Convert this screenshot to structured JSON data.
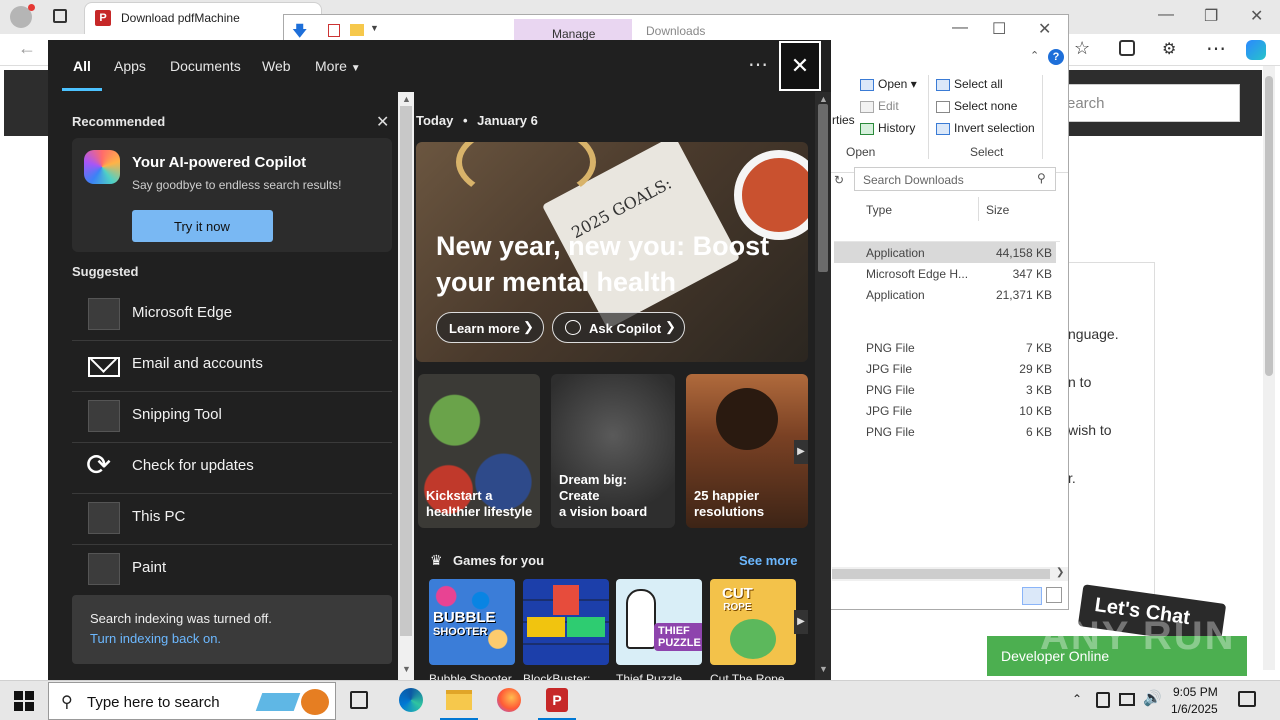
{
  "browser": {
    "tab_title": "Download pdfMachine",
    "page_search_placeholder": "earch",
    "page_text_lines": [
      "nguage.",
      "n to",
      "wish to",
      "r."
    ]
  },
  "explorer": {
    "manage_label": "Manage",
    "title": "Downloads",
    "ribbon": {
      "open_label": "Open",
      "edit_label": "Edit",
      "history_label": "History",
      "open_group": "Open",
      "properties_partial": "rties",
      "select_all": "Select all",
      "select_none": "Select none",
      "invert_selection": "Invert selection",
      "select_group": "Select"
    },
    "search_placeholder": "Search Downloads",
    "columns": [
      "Type",
      "Size"
    ],
    "rows": [
      {
        "type": "Application",
        "size": "44,158 KB"
      },
      {
        "type": "Microsoft Edge H...",
        "size": "347 KB"
      },
      {
        "type": "Application",
        "size": "21,371 KB"
      },
      {
        "type": "PNG File",
        "size": "7 KB"
      },
      {
        "type": "JPG File",
        "size": "29 KB"
      },
      {
        "type": "PNG File",
        "size": "3 KB"
      },
      {
        "type": "JPG File",
        "size": "10 KB"
      },
      {
        "type": "PNG File",
        "size": "6 KB"
      }
    ]
  },
  "search_panel": {
    "tabs": [
      "All",
      "Apps",
      "Documents",
      "Web",
      "More"
    ],
    "recommended_label": "Recommended",
    "copilot": {
      "title": "Your AI-powered Copilot",
      "subtitle": "Say goodbye to endless search results!",
      "button": "Try it now"
    },
    "suggested_label": "Suggested",
    "suggested": [
      "Microsoft Edge",
      "Email and accounts",
      "Snipping Tool",
      "Check for updates",
      "This PC",
      "Paint"
    ],
    "indexing": {
      "text": "Search indexing was turned off.",
      "link": "Turn indexing back on."
    },
    "today": "Today",
    "date": "January 6",
    "hero": {
      "image_text": "2025 GOALS:",
      "headline_1": "New year, new you: Boost",
      "headline_2": "your mental health",
      "learn_more": "Learn more",
      "ask_copilot": "Ask Copilot"
    },
    "cards": [
      {
        "line1": "Kickstart a",
        "line2": "healthier lifestyle"
      },
      {
        "line1": "Dream big: Create",
        "line2": "a vision board"
      },
      {
        "line1": "25 happier",
        "line2": "resolutions"
      }
    ],
    "games_label": "Games for you",
    "see_more": "See more",
    "games": [
      "Bubble Shooter...",
      "BlockBuster:...",
      "Thief Puzzle...",
      "Cut The Rope..."
    ],
    "game_art": [
      "BUBBLE",
      "SHOOTER",
      "THIEF",
      "PUZZLE",
      "CUT",
      "ROPE"
    ]
  },
  "overlay": {
    "lets_chat": "Let's Chat",
    "developer_online": "Developer Online",
    "watermark": "ANY RUN"
  },
  "taskbar": {
    "search_placeholder": "Type here to search",
    "time": "9:05 PM",
    "date": "1/6/2025"
  }
}
